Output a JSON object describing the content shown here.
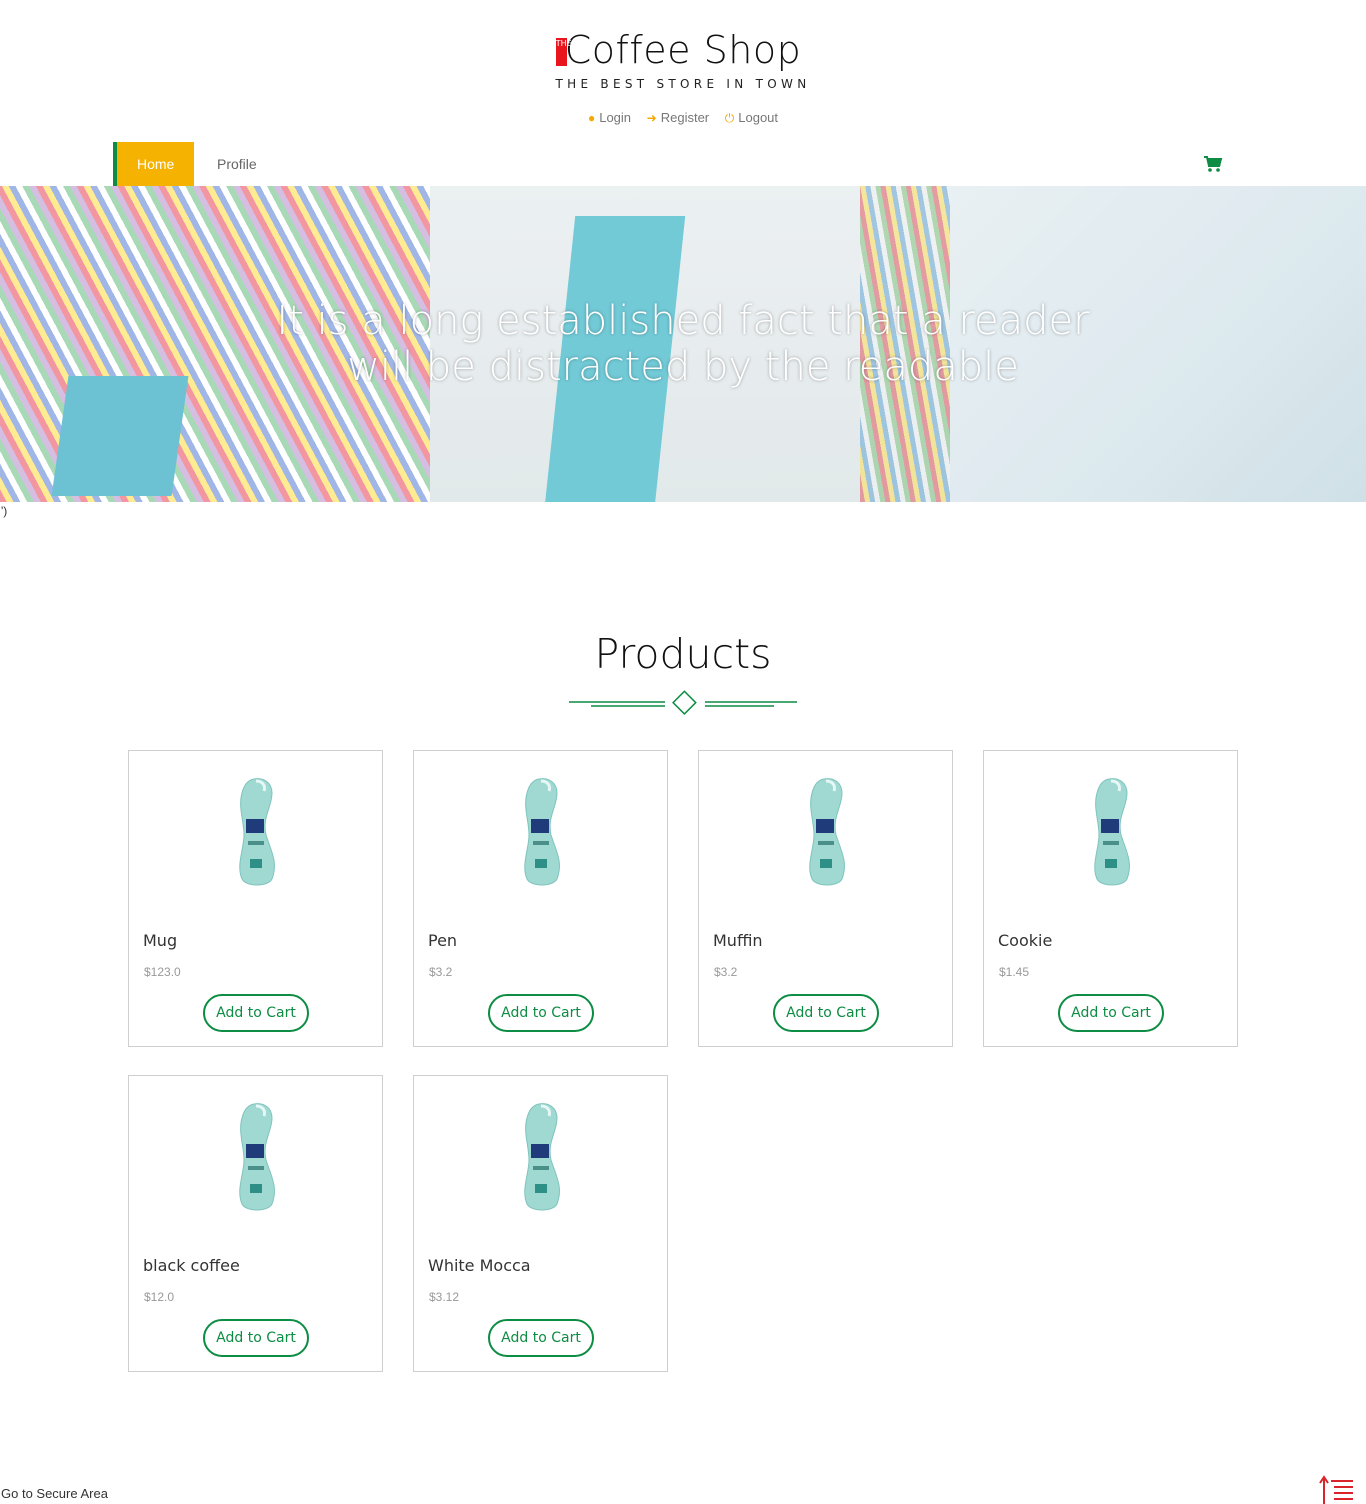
{
  "brand": {
    "the": "THE",
    "title": "Coffee Shop",
    "tagline": "THE BEST STORE IN TOWN"
  },
  "auth": {
    "login": "Login",
    "register": "Register",
    "logout": "Logout"
  },
  "nav": {
    "home": "Home",
    "profile": "Profile"
  },
  "hero": {
    "line1": "It is a long established fact that a reader",
    "line2": "will be distracted by the readable"
  },
  "stray_text": "')",
  "products": {
    "title": "Products",
    "add_label": "Add to Cart",
    "items": [
      {
        "name": "Mug",
        "price": "$123.0"
      },
      {
        "name": "Pen",
        "price": "$3.2"
      },
      {
        "name": "Muffin",
        "price": "$3.2"
      },
      {
        "name": "Cookie",
        "price": "$1.45"
      },
      {
        "name": "black coffee",
        "price": "$12.0"
      },
      {
        "name": "White Mocca",
        "price": "$3.12"
      }
    ]
  },
  "footer": {
    "secure_link": "Go to Secure Area"
  },
  "colors": {
    "accent": "#f5b200",
    "green": "#0d8c43",
    "logo_red": "#e8151d"
  }
}
